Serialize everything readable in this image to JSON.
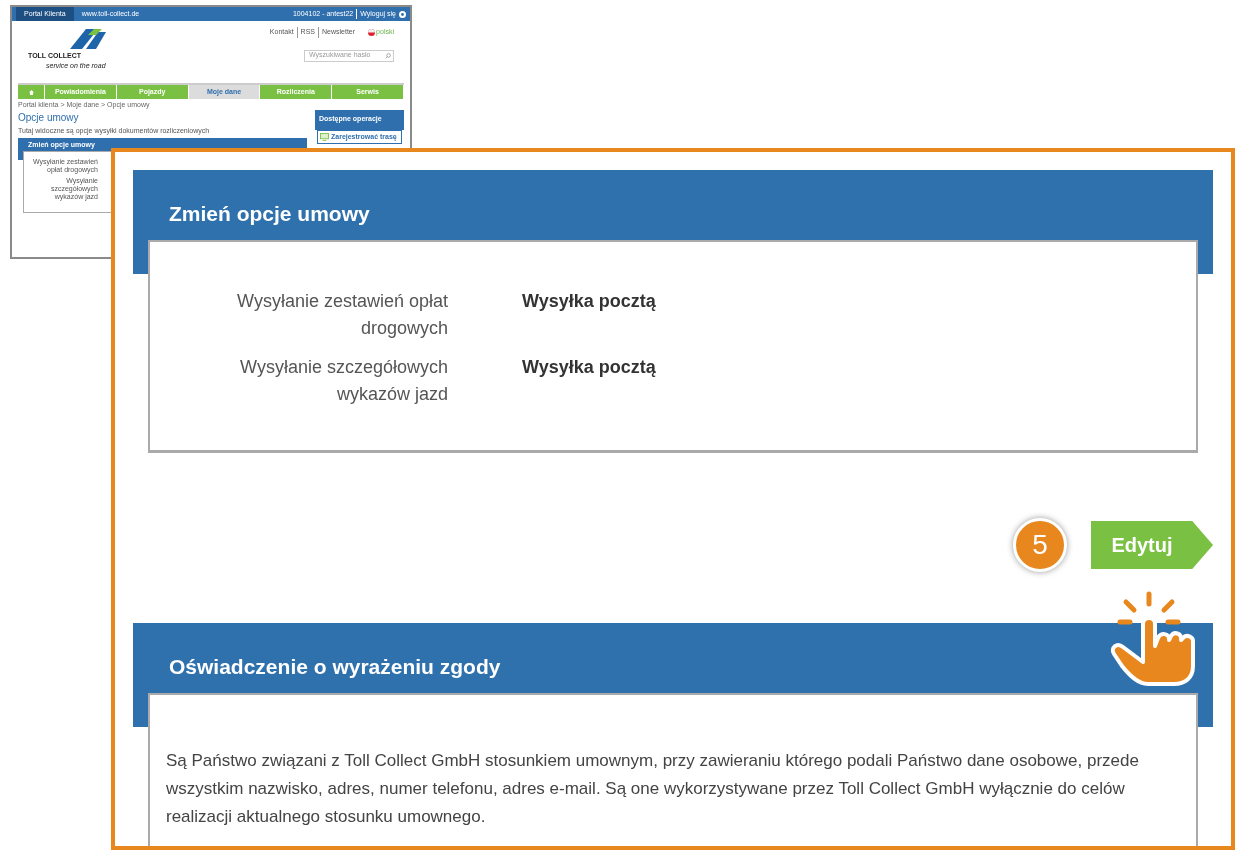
{
  "mini_page": {
    "top_bar": {
      "tabs": [
        {
          "label": "Portal Klienta",
          "selected": true
        },
        {
          "label": "www.toll-collect.de",
          "selected": false
        }
      ],
      "user": "1004102 - antest22",
      "logout": "Wyloguj się"
    },
    "logo": {
      "name": "TOLL COLLECT",
      "tagline": "service on the road"
    },
    "links": [
      "Kontakt",
      "RSS",
      "Newsletter"
    ],
    "language": "polski",
    "search": {
      "placeholder": "Wyszukiwane hasło"
    },
    "nav": [
      {
        "kind": "home",
        "selected": false
      },
      {
        "kind": "text",
        "label": "Powiadomienia",
        "selected": false
      },
      {
        "kind": "text",
        "label": "Pojazdy",
        "selected": false
      },
      {
        "kind": "text",
        "label": "Moje dane",
        "selected": true
      },
      {
        "kind": "text",
        "label": "Rozliczenia",
        "selected": false
      },
      {
        "kind": "text",
        "label": "Serwis",
        "selected": false
      }
    ],
    "breadcrumb": "Portal klienta > Moje dane > Opcje umowy",
    "title": "Opcje umowy",
    "description": "Tutaj widoczne są opcje wysyłki dokumentów rozliczeniowych",
    "card": {
      "title": "Zmień opcje umowy",
      "rows": [
        "Wysyłanie zestawień opłat drogowych",
        "Wysyłanie szczegółowych wykazów jazd"
      ]
    },
    "sidebar": {
      "title": "Dostępne operacje",
      "items": [
        "Zarejestrować trasę"
      ]
    }
  },
  "zoom": {
    "sections": [
      {
        "title": "Zmień opcje umowy",
        "rows": [
          {
            "label": "Wysyłanie zestawień opłat drogowych",
            "value": "Wysyłka pocztą"
          },
          {
            "label": "Wysyłanie szczegółowych wykazów jazd",
            "value": "Wysyłka pocztą"
          }
        ]
      },
      {
        "title": "Oświadczenie o wyrażeniu zgody",
        "paragraph": "Są Państwo związani z Toll Collect GmbH stosunkiem umownym, przy zawieraniu którego podali Państwo dane osobowe, przede wszystkim nazwisko, adres, numer telefonu, adres e-mail. Są one wykorzystywane przez Toll Collect GmbH wyłącznie do celów realizacji aktualnego stosunku umownego."
      }
    ],
    "button": "Edytuj",
    "step": "5"
  }
}
